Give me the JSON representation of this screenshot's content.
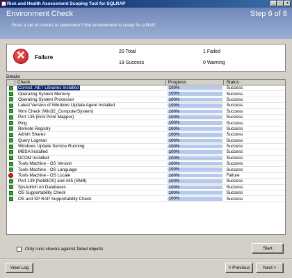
{
  "window": {
    "title": "Risk and Health Assessment Scoping Tool for SQLRAP",
    "minimize": "_",
    "maximize": "□",
    "close": "×"
  },
  "header": {
    "title": "Environment Check",
    "step": "Step 6 of 8",
    "description": "Runs a set of checks to determine if the environment is ready for a RAP."
  },
  "summary": {
    "status": "Failure",
    "total": "20 Total",
    "success": "19 Success",
    "failed": "1 Failed",
    "warning": "0 Warning"
  },
  "details_label": "Details",
  "table": {
    "columns": [
      "Check",
      "Progress",
      "Status"
    ],
    "rows": [
      {
        "check": "Correct .NET Libraries Installed",
        "progress": "100%",
        "status": "Success",
        "icon": "success-icon"
      },
      {
        "check": "Operating System Memory",
        "progress": "100%",
        "status": "Success",
        "icon": "success-icon"
      },
      {
        "check": "Operating System Processor",
        "progress": "100%",
        "status": "Success",
        "icon": "success-icon"
      },
      {
        "check": "Latest Version of Windows Update Agent Installed",
        "progress": "100%",
        "status": "Success",
        "icon": "success-icon"
      },
      {
        "check": "Wmi Check (Win32_ComputerSystem)",
        "progress": "100%",
        "status": "Success",
        "icon": "success-icon"
      },
      {
        "check": "Port 135 (End Point Mapper)",
        "progress": "100%",
        "status": "Success",
        "icon": "success-icon"
      },
      {
        "check": "Ping",
        "progress": "100%",
        "status": "Success",
        "icon": "success-icon"
      },
      {
        "check": "Remote Registry",
        "progress": "100%",
        "status": "Success",
        "icon": "success-icon"
      },
      {
        "check": "Admin Shares",
        "progress": "100%",
        "status": "Success",
        "icon": "success-icon"
      },
      {
        "check": "Query Logman",
        "progress": "100%",
        "status": "Success",
        "icon": "success-icon"
      },
      {
        "check": "Windows Update Service Running",
        "progress": "100%",
        "status": "Success",
        "icon": "success-icon"
      },
      {
        "check": "MBSA Installed",
        "progress": "100%",
        "status": "Success",
        "icon": "success-icon"
      },
      {
        "check": "DCOM Installed",
        "progress": "100%",
        "status": "Success",
        "icon": "success-icon"
      },
      {
        "check": "Tools Machine - OS Version",
        "progress": "100%",
        "status": "Success",
        "icon": "success-icon"
      },
      {
        "check": "Tools Machine - OS Language",
        "progress": "100%",
        "status": "Success",
        "icon": "success-icon"
      },
      {
        "check": "Tools Machine - OS Locale",
        "progress": "100%",
        "status": "Failure",
        "icon": "failure-icon"
      },
      {
        "check": "Port 139 (NetBIOS) and 445 (SMB)",
        "progress": "100%",
        "status": "Success",
        "icon": "success-icon"
      },
      {
        "check": "SysAdmin on Databases",
        "progress": "100%",
        "status": "Success",
        "icon": "success-icon"
      },
      {
        "check": "OS Supportability Check",
        "progress": "100%",
        "status": "Success",
        "icon": "success-icon"
      },
      {
        "check": "OS and SP RAP Supportability Check",
        "progress": "100%",
        "status": "Success",
        "icon": "success-icon"
      }
    ]
  },
  "options": {
    "only_failed_label": "Only runs checks against failed objects."
  },
  "buttons": {
    "start": "Start",
    "view_log": "View Log",
    "previous": "< Previous",
    "next": "Next >"
  },
  "colors": {
    "header_bg": "#8aa0cc",
    "progress_fill": "#b5c9ec",
    "success": "#35a035",
    "failure": "#d02020"
  }
}
